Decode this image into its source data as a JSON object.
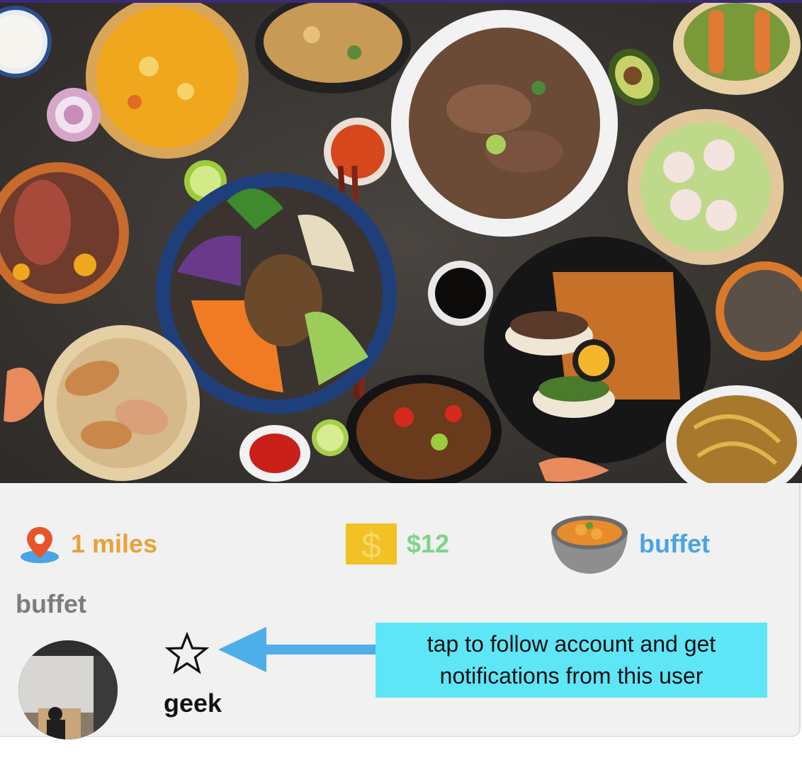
{
  "hero": {
    "image_name": "asian-food-table-photo"
  },
  "stats": {
    "distance": {
      "label": "1 miles",
      "icon": "map-pin-icon",
      "color": "#e9a13a"
    },
    "price": {
      "label": "$12",
      "icon": "dollar-icon",
      "color": "#7fd38a"
    },
    "type": {
      "label": "buffet",
      "icon": "soup-bowl-icon",
      "color": "#4aa3e6"
    }
  },
  "post": {
    "category": "buffet",
    "username": "geek",
    "follow_icon": "star-outline-icon"
  },
  "annotation": {
    "text": "tap to follow account and get notifications from this user",
    "background": "#5ee6f7",
    "arrow_color": "#4eaee8"
  }
}
